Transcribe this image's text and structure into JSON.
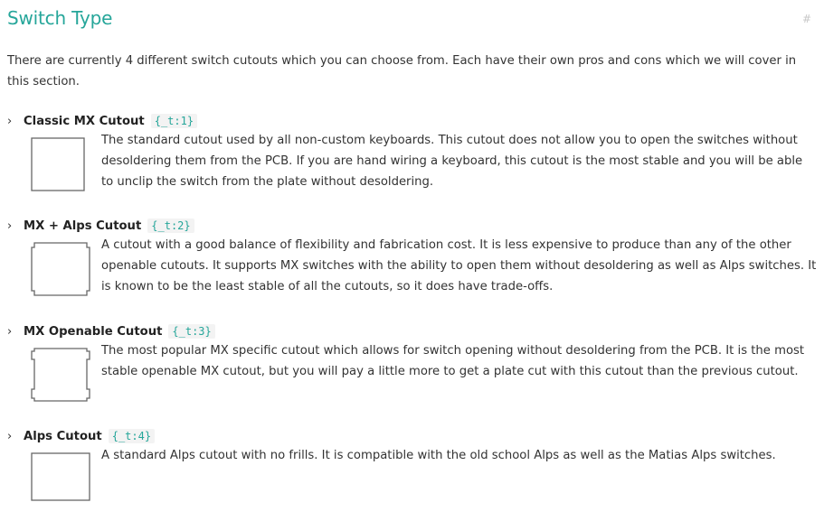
{
  "section": {
    "title": "Switch Type",
    "anchor": "#",
    "intro": "There are currently 4 different switch cutouts which you can choose from. Each have their own pros and cons which we will cover in this section."
  },
  "items": [
    {
      "name": "Classic MX Cutout",
      "code": "{_t:1}",
      "icon": "classic-mx-cutout-icon",
      "description": "The standard cutout used by all non-custom keyboards. This cutout does not allow you to open the switches without desoldering them from the PCB. If you are hand wiring a keyboard, this cutout is the most stable and you will be able to unclip the switch from the plate without desoldering."
    },
    {
      "name": "MX + Alps Cutout",
      "code": "{_t:2}",
      "icon": "mx-alps-cutout-icon",
      "description": "A cutout with a good balance of flexibility and fabrication cost. It is less expensive to produce than any of the other openable cutouts. It supports MX switches with the ability to open them without desoldering as well as Alps switches. It is known to be the least stable of all the cutouts, so it does have trade-offs."
    },
    {
      "name": "MX Openable Cutout",
      "code": "{_t:3}",
      "icon": "mx-openable-cutout-icon",
      "description": "The most popular MX specific cutout which allows for switch opening without desoldering from the PCB. It is the most stable openable MX cutout, but you will pay a little more to get a plate cut with this cutout than the previous cutout."
    },
    {
      "name": "Alps Cutout",
      "code": "{_t:4}",
      "icon": "alps-cutout-icon",
      "description": "A standard Alps cutout with no frills. It is compatible with the old school Alps as well as the Matias Alps switches."
    }
  ],
  "colors": {
    "accent": "#26a69a",
    "text": "#333333",
    "code_bg": "#f3f3f3"
  }
}
